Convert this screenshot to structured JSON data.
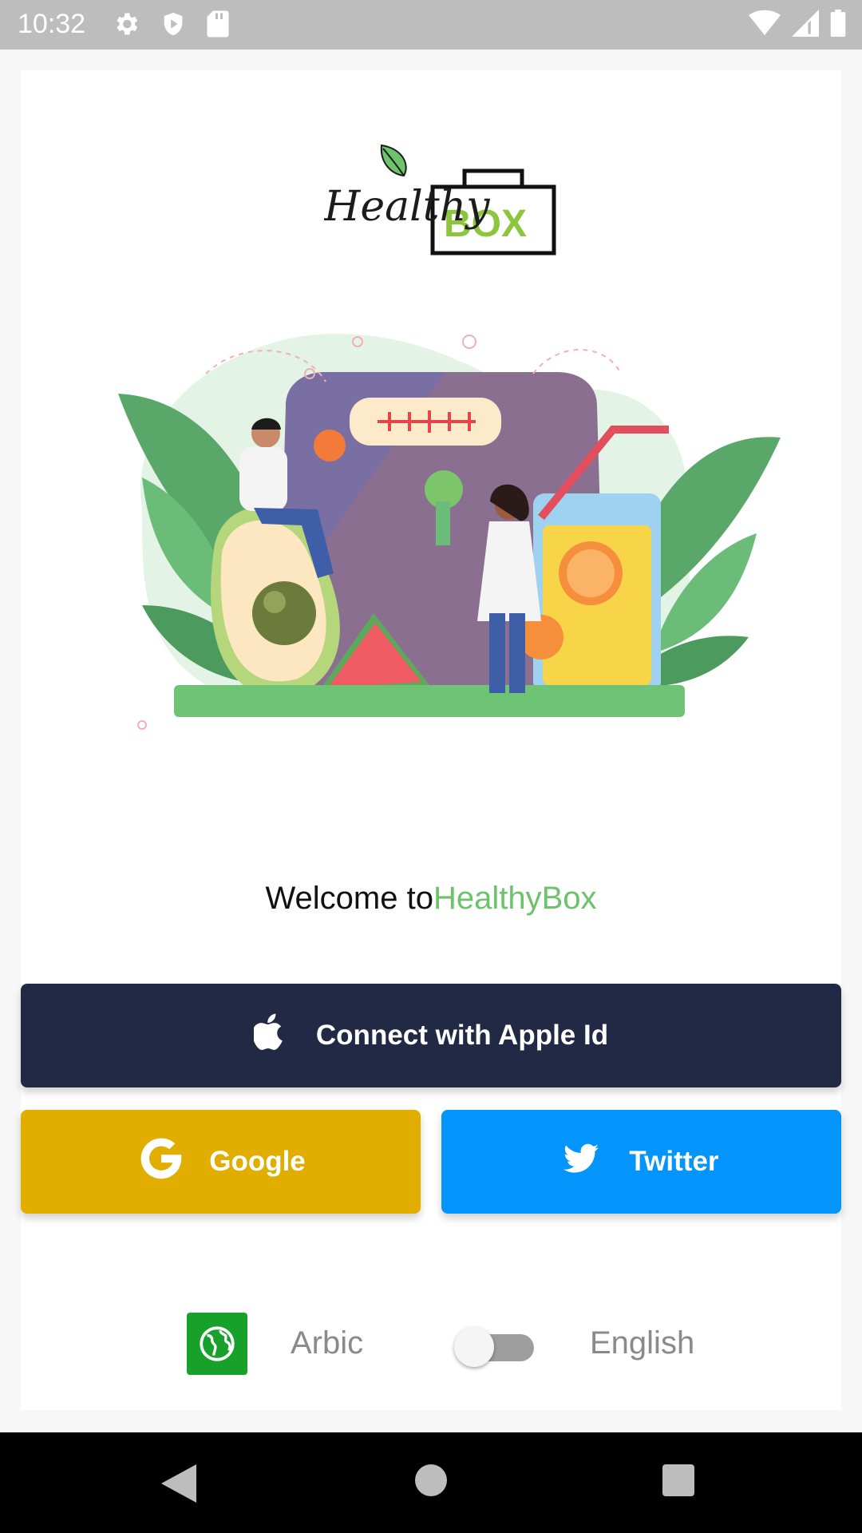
{
  "status_bar": {
    "time": "10:32",
    "icons": [
      "gear-icon",
      "shield-icon",
      "sd-card-icon",
      "wifi-icon",
      "signal-icon",
      "battery-icon"
    ]
  },
  "logo": {
    "text_script": "Healthy",
    "text_box": "BOX"
  },
  "welcome": {
    "prefix": "Welcome to",
    "brand": "HealthyBox"
  },
  "buttons": {
    "apple": {
      "label": "Connect with Apple Id",
      "color": "#212945"
    },
    "google": {
      "label": "Google",
      "color": "#e1ae00"
    },
    "twitter": {
      "label": "Twitter",
      "color": "#0395fb"
    }
  },
  "language": {
    "arabic_label": "Arbic",
    "english_label": "English",
    "toggle_on": false
  },
  "colors": {
    "brand_green": "#6cc36b",
    "globe_green": "#17a12a"
  },
  "nav_bar": {
    "icons": [
      "back-icon",
      "home-icon",
      "recents-icon"
    ]
  }
}
